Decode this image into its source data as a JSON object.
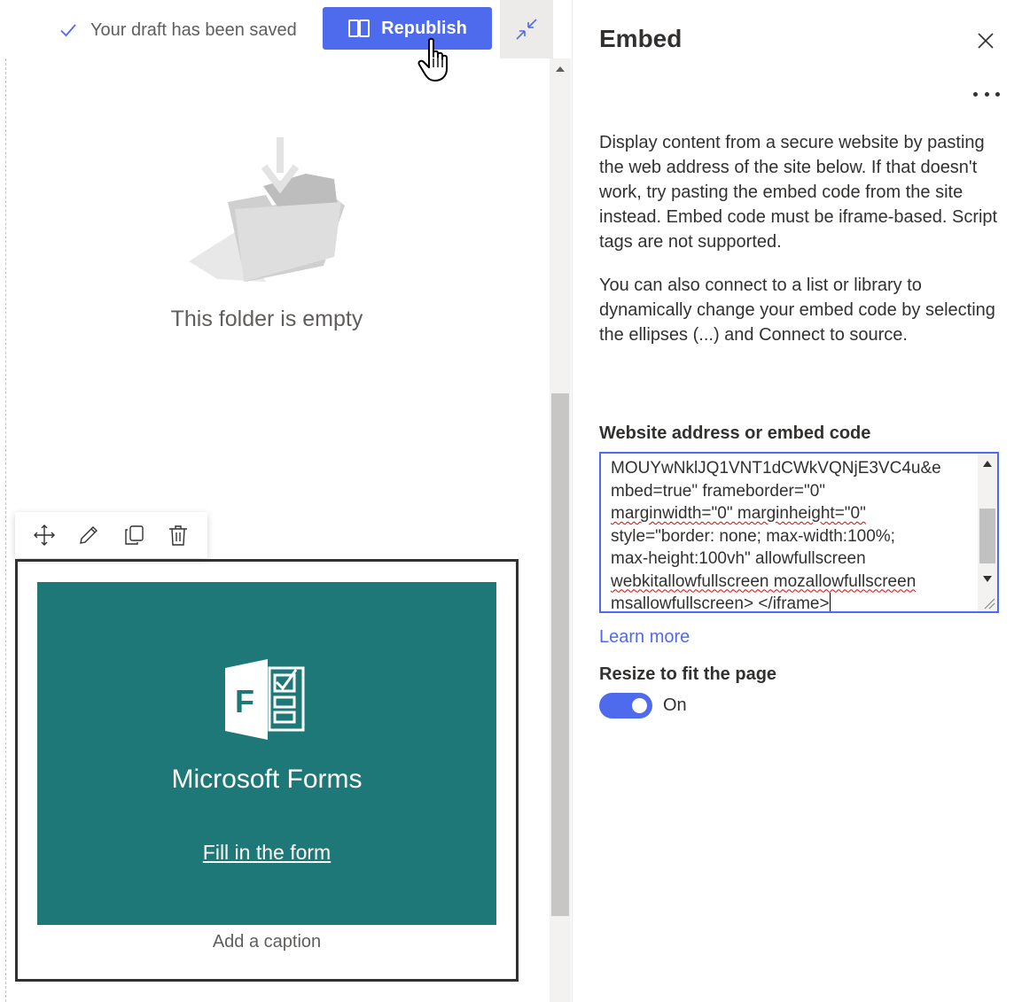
{
  "status": {
    "draft_text": "Your draft has been saved"
  },
  "toolbar": {
    "republish_label": "Republish"
  },
  "icons": {
    "check": "check-icon",
    "book": "book-open-icon",
    "collapse": "collapse-arrows-icon",
    "move": "move-icon",
    "edit": "pencil-icon",
    "duplicate": "copy-icon",
    "delete": "trash-icon",
    "close": "close-icon",
    "more": "more-ellipsis-icon",
    "forms_logo": "microsoft-forms-icon",
    "cursor": "hand-pointer-cursor"
  },
  "canvas": {
    "empty_folder_text": "This folder is empty",
    "forms_card": {
      "title": "Microsoft Forms",
      "link_text": "Fill in the form",
      "background": "#1e7878"
    },
    "caption_placeholder": "Add a caption"
  },
  "panel": {
    "title": "Embed",
    "description_1": "Display content from a secure website by pasting the web address of the site below. If that doesn't work, try pasting the embed code from the site instead. Embed code must be iframe-based. Script tags are not supported.",
    "description_2": "You can also connect to a list or library to dynamically change your embed code by selecting the ellipses (...) and Connect to source.",
    "field_label": "Website address or embed code",
    "embed_code_lines": [
      "MOUYwNklJQ1VNT1dCWkVQNjE3VC4u&e",
      "mbed=true\" frameborder=\"0\"",
      "marginwidth=\"0\" marginheight=\"0\"",
      "style=\"border: none; max-width:100%;",
      "max-height:100vh\" allowfullscreen",
      "webkitallowfullscreen mozallowfullscreen",
      "msallowfullscreen> </iframe>"
    ],
    "learn_more": "Learn more",
    "resize_label": "Resize to fit the page",
    "resize_state": "On",
    "accent_color": "#4f6bed"
  }
}
